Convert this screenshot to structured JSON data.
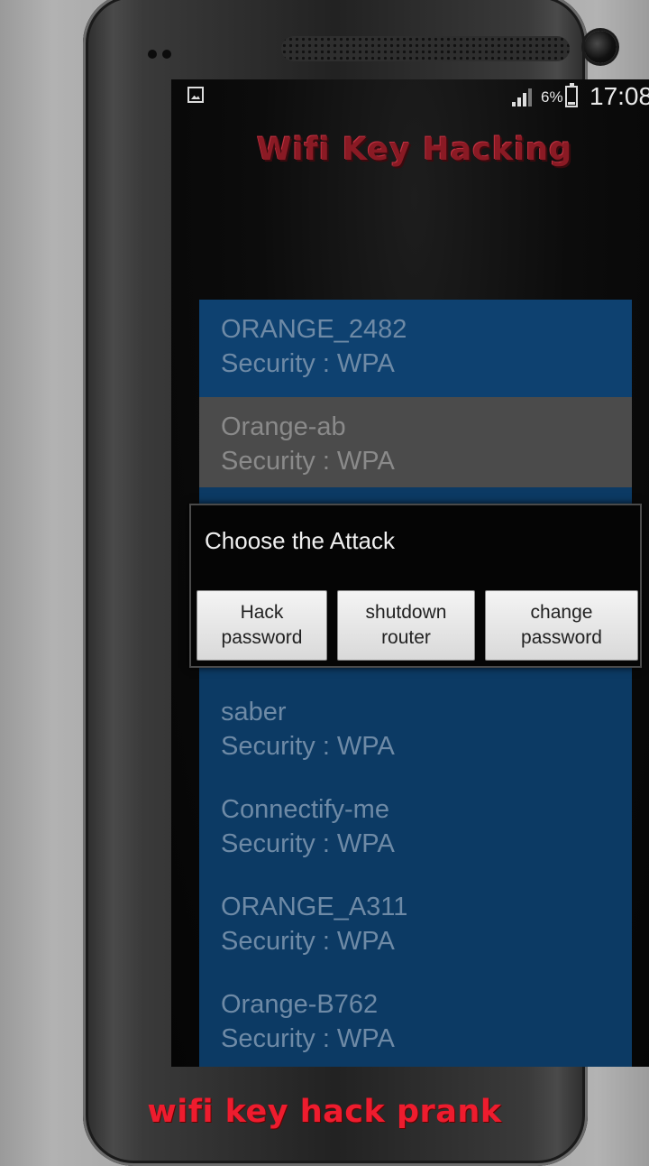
{
  "status_bar": {
    "battery_percent": "6%",
    "time": "17:08"
  },
  "app": {
    "title": "Wifi Key Hacking"
  },
  "networks": [
    {
      "ssid": "ORANGE_2482",
      "security": "Security : WPA"
    },
    {
      "ssid": "Orange-ab",
      "security": "Security : WPA"
    },
    {
      "ssid": "saber",
      "security": "Security : WPA"
    },
    {
      "ssid": "Connectify-me",
      "security": "Security : WPA"
    },
    {
      "ssid": "ORANGE_A311",
      "security": "Security : WPA"
    },
    {
      "ssid": "Orange-B762",
      "security": "Security : WPA"
    }
  ],
  "dialog": {
    "title": "Choose the Attack",
    "buttons": [
      {
        "label": "Hack\npassword"
      },
      {
        "label": "shutdown\nrouter"
      },
      {
        "label": "change\npassword"
      }
    ]
  },
  "footer_banner": "wifi key hack prank",
  "colors": {
    "list_background": "#0c3a64",
    "selected_row": "#4b4b4b",
    "title_red": "#8a1a24",
    "banner_red": "#ee1c2e"
  },
  "icons": [
    "image-notification-icon",
    "signal-icon",
    "battery-icon"
  ]
}
